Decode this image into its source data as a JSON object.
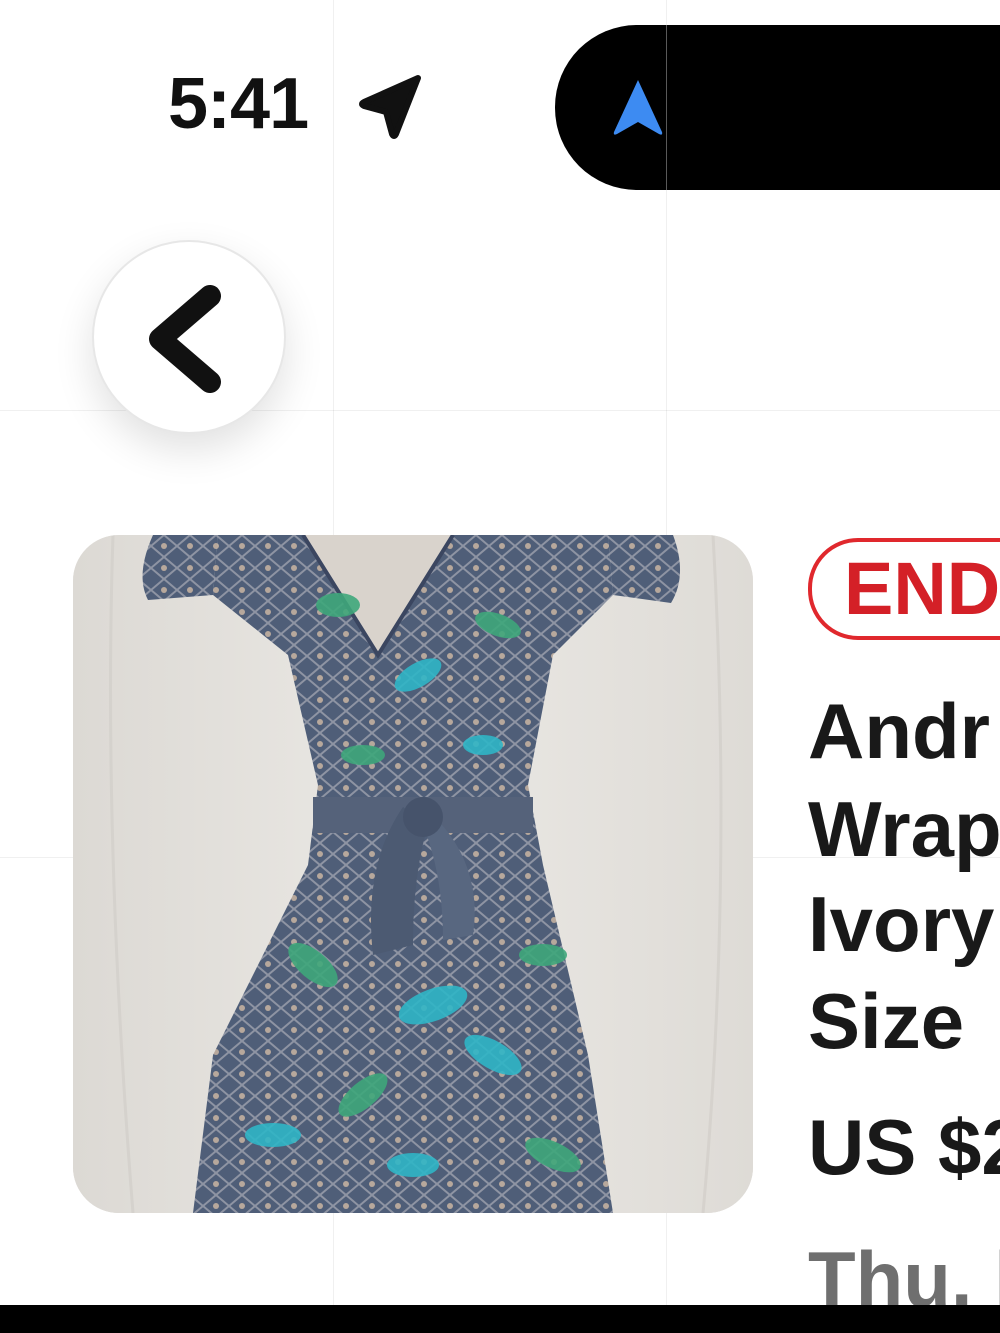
{
  "status_bar": {
    "time": "5:41",
    "location_icon": "location-arrow-icon",
    "island_icon": "navigation-arrow-icon",
    "island_icon_color": "#3d8bf2"
  },
  "navigation": {
    "back_icon": "chevron-left-icon"
  },
  "listing": {
    "image_alt": "wrap dress",
    "status_badge": "END",
    "status_color": "#e0282d",
    "title_lines": [
      "Andr",
      "Wrap",
      "Ivory",
      "Size"
    ],
    "price": "US $2",
    "end_date": "Thu. l"
  }
}
